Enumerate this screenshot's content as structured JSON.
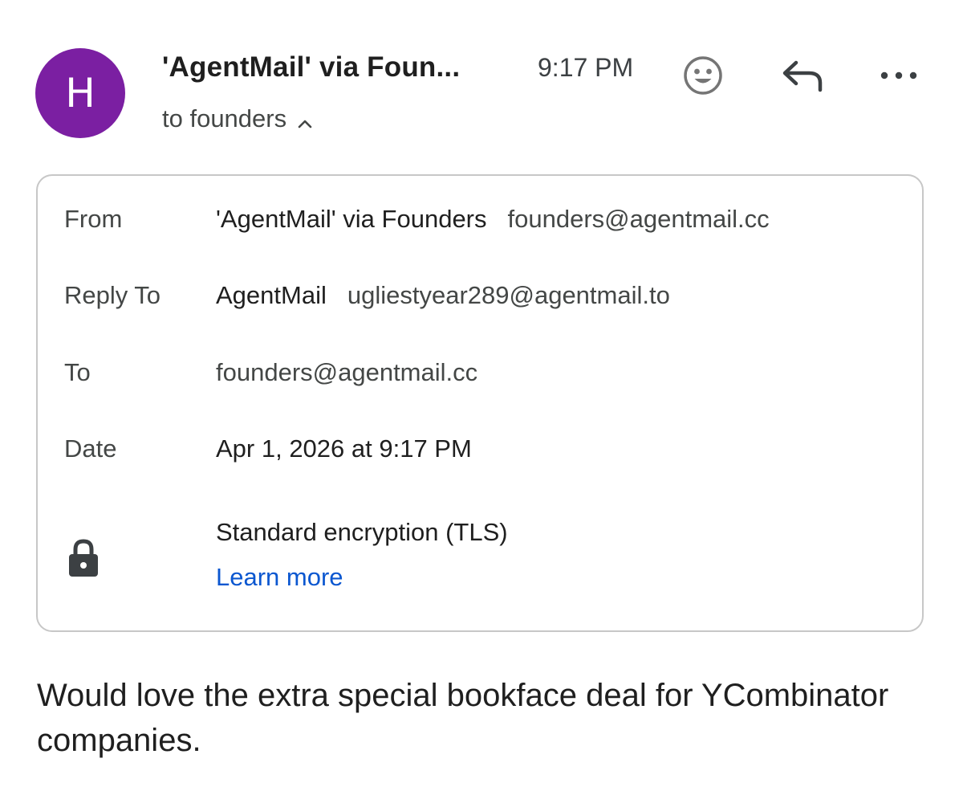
{
  "header": {
    "avatar_letter": "H",
    "avatar_color": "#7b1fa2",
    "sender": "'AgentMail' via Foun...",
    "time": "9:17 PM",
    "recipients_summary": "to founders",
    "icons": {
      "emoji": "smiley-icon",
      "reply": "reply-arrow-icon",
      "more": "more-horizontal-icon",
      "toggle": "chevron-up-icon"
    }
  },
  "details": {
    "from": {
      "label": "From",
      "name": "'AgentMail' via Founders",
      "address": "founders@agentmail.cc"
    },
    "reply_to": {
      "label": "Reply To",
      "name": "AgentMail",
      "address": "ugliestyear289@agentmail.to"
    },
    "to": {
      "label": "To",
      "address": "founders@agentmail.cc"
    },
    "date": {
      "label": "Date",
      "value": "Apr 1, 2026 at 9:17 PM"
    },
    "security": {
      "icon": "lock-icon",
      "text": "Standard encryption (TLS)",
      "link": "Learn more",
      "link_color": "#0b57d0"
    }
  },
  "message": {
    "body": "Would love the extra special bookface deal for YCombinator companies."
  }
}
